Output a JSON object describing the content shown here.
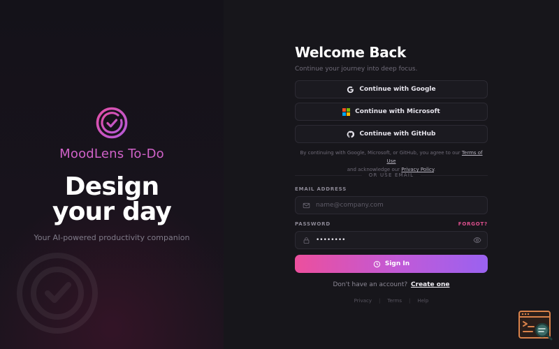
{
  "brand": {
    "name": "MoodLens To-Do",
    "hero_title_line1": "Design",
    "hero_title_line2": "your day",
    "tagline": "Your AI-powered productivity companion",
    "accent_color": "#d062c8"
  },
  "form": {
    "title": "Welcome Back",
    "subtitle": "Continue your journey into deep focus.",
    "sso": {
      "google": "Continue with Google",
      "microsoft": "Continue with Microsoft",
      "github": "Continue with GitHub"
    },
    "legal": {
      "prefix": "By continuing with Google, Microsoft, or GitHub, you agree to our",
      "terms_link": "Terms of Use",
      "middle": "and acknowledge our",
      "privacy_link": "Privacy Policy",
      "suffix": "."
    },
    "divider": "OR USE EMAIL",
    "email": {
      "label": "EMAIL ADDRESS",
      "placeholder": "name@company.com",
      "value": ""
    },
    "password": {
      "label": "PASSWORD",
      "forgot": "FORGOT?",
      "value": "password"
    },
    "signin_label": "Sign In",
    "signup_prompt": "Don't have an account?",
    "signup_link": "Create one",
    "gradient_colors": [
      "#ec4f9d",
      "#9a62f0"
    ]
  },
  "footer": {
    "privacy": "Privacy",
    "terms": "Terms",
    "help": "Help",
    "separator": "|"
  },
  "icons": {
    "brand": "target-check-icon",
    "google": "google-icon",
    "microsoft": "microsoft-icon",
    "github": "github-icon",
    "email": "mail-icon",
    "password": "lock-icon",
    "reveal": "eye-icon",
    "signin": "clock-icon",
    "corner": "terminal-search-icon"
  }
}
